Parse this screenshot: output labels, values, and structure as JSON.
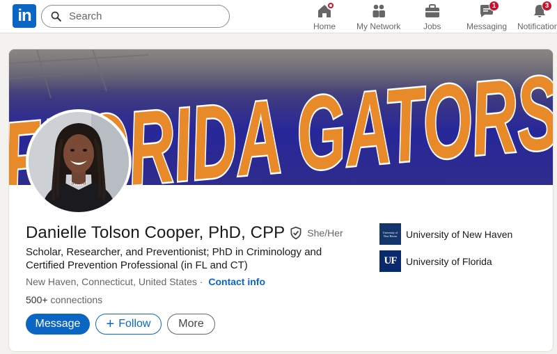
{
  "nav": {
    "logo_text": "in",
    "search_placeholder": "Search",
    "items": [
      {
        "label": "Home",
        "icon": "home-icon",
        "badge": ""
      },
      {
        "label": "My Network",
        "icon": "network-icon",
        "badge": ""
      },
      {
        "label": "Jobs",
        "icon": "briefcase-icon",
        "badge": ""
      },
      {
        "label": "Messaging",
        "icon": "messaging-icon",
        "badge": "1"
      },
      {
        "label": "Notifications",
        "icon": "bell-icon",
        "badge": "3"
      }
    ]
  },
  "profile": {
    "name": "Danielle Tolson Cooper, PhD, CPP",
    "pronouns": "She/Her",
    "headline": "Scholar, Researcher, and Preventionist; PhD in Criminology and Certified Prevention Professional (in FL and CT)",
    "location": "New Haven, Connecticut, United States",
    "separator": "·",
    "contact_label": "Contact info",
    "connections_count": "500+",
    "connections_label": "connections",
    "banner_text": "FLORIDA GATORS"
  },
  "actions": {
    "message_label": "Message",
    "follow_label": "Follow",
    "more_label": "More"
  },
  "education": [
    {
      "name": "University of New Haven",
      "logo_text": "University of New Haven"
    },
    {
      "name": "University of Florida",
      "logo_text": "UF"
    }
  ],
  "colors": {
    "brand": "#0a66c2",
    "badge": "#cb112d",
    "banner_orange": "#e8892a",
    "banner_blue": "#2a2a9a"
  }
}
